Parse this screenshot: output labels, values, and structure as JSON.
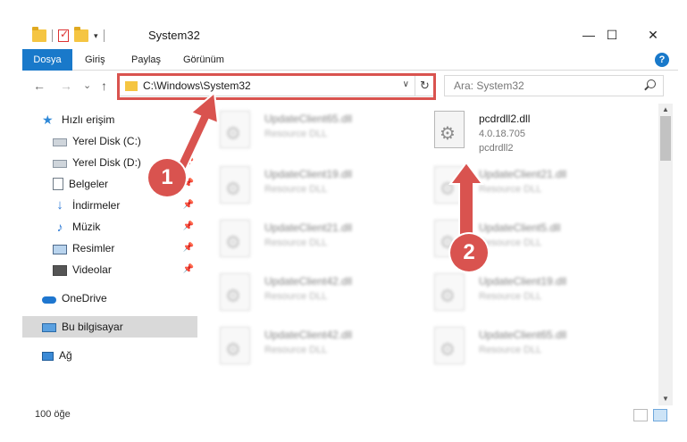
{
  "window": {
    "title": "System32",
    "minimize": "—",
    "maximize": "☐",
    "close": "✕"
  },
  "ribbon": {
    "tabs": [
      "Dosya",
      "Giriş",
      "Paylaş",
      "Görünüm"
    ],
    "help": "?"
  },
  "nav": {
    "back": "←",
    "forward": "→",
    "recent": "⌄",
    "up": "↑",
    "address": "C:\\Windows\\System32",
    "refresh": "↻",
    "search_placeholder": "Ara: System32"
  },
  "sidebar": {
    "items": [
      {
        "label": "Hızlı erişim",
        "icon": "star-icon",
        "pinned": false
      },
      {
        "label": "Yerel Disk (C:)",
        "icon": "disk-icon",
        "pinned": false
      },
      {
        "label": "Yerel Disk (D:)",
        "icon": "disk-icon",
        "pinned": true
      },
      {
        "label": "Belgeler",
        "icon": "document-icon",
        "pinned": true
      },
      {
        "label": "İndirmeler",
        "icon": "download-icon",
        "pinned": true
      },
      {
        "label": "Müzik",
        "icon": "music-icon",
        "pinned": true
      },
      {
        "label": "Resimler",
        "icon": "pictures-icon",
        "pinned": true
      },
      {
        "label": "Videolar",
        "icon": "video-icon",
        "pinned": true
      },
      {
        "label": "OneDrive",
        "icon": "cloud-icon",
        "pinned": false
      },
      {
        "label": "Bu bilgisayar",
        "icon": "computer-icon",
        "pinned": false,
        "selected": true
      },
      {
        "label": "Ağ",
        "icon": "network-icon",
        "pinned": false
      }
    ]
  },
  "files": [
    {
      "name": "UpdateClient65.dll",
      "type": "Resource DLL",
      "blurred": true
    },
    {
      "name": "pcdrdll2.dll",
      "version": "4.0.18.705",
      "desc": "pcdrdll2",
      "blurred": false
    },
    {
      "name": "UpdateClient19.dll",
      "type": "Resource DLL",
      "blurred": true
    },
    {
      "name": "UpdateClient21.dll",
      "type": "Resource DLL",
      "blurred": true
    },
    {
      "name": "UpdateClient21.dll",
      "type": "Resource DLL",
      "blurred": true
    },
    {
      "name": "UpdateClient5.dll",
      "type": "Resource DLL",
      "blurred": true
    },
    {
      "name": "UpdateClient42.dll",
      "type": "Resource DLL",
      "blurred": true
    },
    {
      "name": "UpdateClient19.dll",
      "type": "Resource DLL",
      "blurred": true
    },
    {
      "name": "UpdateClient42.dll",
      "type": "Resource DLL",
      "blurred": true
    },
    {
      "name": "UpdateClient65.dll",
      "type": "Resource DLL",
      "blurred": true
    }
  ],
  "status": {
    "count": "100 öğe"
  },
  "callouts": [
    "1",
    "2"
  ],
  "colors": {
    "accent": "#1979ca",
    "highlight": "#d9534f"
  }
}
